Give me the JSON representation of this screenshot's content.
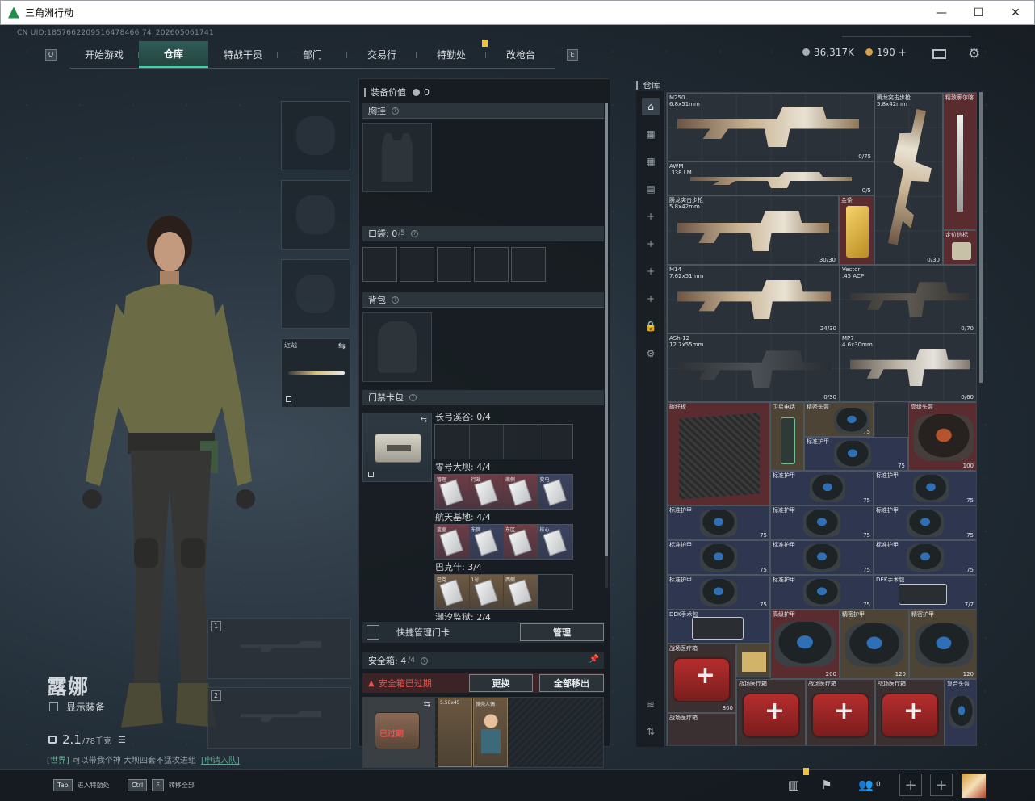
{
  "window": {
    "title": "三角洲行动",
    "minimize": "—",
    "maximize": "☐",
    "close": "✕"
  },
  "uid": "CN UID:1857662209516478466 74_202605061741",
  "nav": {
    "left_key": "Q",
    "right_key": "E",
    "tabs": [
      "开始游戏",
      "仓库",
      "特战干员",
      "部门",
      "交易行",
      "特勤处",
      "改枪台"
    ],
    "active_tab": "仓库"
  },
  "currency": {
    "coins": "36,317K",
    "points": "190",
    "plus": "+",
    "coins_color": "#a7afb5",
    "points_color": "#d3a24d"
  },
  "character": {
    "name": "露娜",
    "show_equipment": "显示装备",
    "weight": "2.1",
    "weight_max": "/78千克"
  },
  "chat": {
    "channel": "[世界]",
    "message": "可以带我个神 大坝四套不猛攻进组",
    "link": "[申请入队]"
  },
  "slots": {
    "melee_label": "近战",
    "weapon_1": "1",
    "weapon_2": "2"
  },
  "equipment_panel": {
    "value_label": "装备价值",
    "value": "0",
    "chest_rig": "胸挂",
    "pockets": "口袋:",
    "pockets_count": "0",
    "pockets_max": "/5",
    "backpack": "背包",
    "keycard_bag": "门禁卡包",
    "keycard_groups": [
      {
        "label": "长弓溪谷: 0/4",
        "cards": []
      },
      {
        "label": "零号大坝: 4/4",
        "cards": [
          "管理",
          "行政",
          "南侧",
          "变电"
        ]
      },
      {
        "label": "航天基地: 4/4",
        "cards": [
          "蓝室",
          "东侧",
          "东区",
          "核心"
        ]
      },
      {
        "label": "巴克什: 3/4",
        "cards": [
          "巴克",
          "1号",
          "西侧"
        ]
      },
      {
        "label": "潮汐监狱: 2/4",
        "cards": []
      }
    ],
    "quick_manage": "快捷管理门卡",
    "manage_button": "管理",
    "safe_box": "安全箱:",
    "safe_count": "4",
    "safe_max": "/4",
    "expired_warning": "安全箱已过期",
    "replace_button": "更换",
    "remove_all_button": "全部移出",
    "case_expired_label": "已过期",
    "safe_items": [
      "5.56x45",
      "弹壳人偶"
    ]
  },
  "warehouse": {
    "title": "仓库",
    "items": [
      {
        "name": "M250\n6.8x51mm",
        "count": "0/75"
      },
      {
        "name": "AWM\n.338 LM",
        "count": "0/5"
      },
      {
        "name": "腾龙突击步枪\n5.8x42mm",
        "count": "0/30"
      },
      {
        "name": "腾龙突击步枪\n5.8x42mm",
        "count": "30/30"
      },
      {
        "name": "M14\n7.62x51mm",
        "count": "24/30"
      },
      {
        "name": "Vector\n.45 ACP",
        "count": "0/70"
      },
      {
        "name": "ASh-12\n12.7x55mm",
        "count": "0/30"
      },
      {
        "name": "MP7\n4.6x30mm",
        "count": "0/60"
      },
      {
        "name": "碳纤板",
        "count": ""
      },
      {
        "name": "卫星电话",
        "count": ""
      },
      {
        "name": "精密头盔",
        "count": "75"
      },
      {
        "name": "高级头盔",
        "count": "100"
      },
      {
        "name": "标准护甲",
        "count": "75"
      },
      {
        "name": "DEK手术包",
        "count": "7/7"
      },
      {
        "name": "战场医疗箱",
        "count": "800"
      },
      {
        "name": "精密护甲",
        "count": "120"
      },
      {
        "name": "高级护甲",
        "count": "200"
      }
    ],
    "extra_labels": [
      "精密头盔",
      "标准护甲",
      "金条",
      "定位信标",
      "战场医疗箱",
      "复合头盔"
    ],
    "side_plus": "+"
  },
  "bottom_bar": {
    "hint_1_key": "Tab",
    "hint_1_text": "进入特勤处",
    "hint_2_key": "Ctrl",
    "hint_2_key2": "F",
    "hint_2_text": "转移全部",
    "friends_count": "0"
  }
}
